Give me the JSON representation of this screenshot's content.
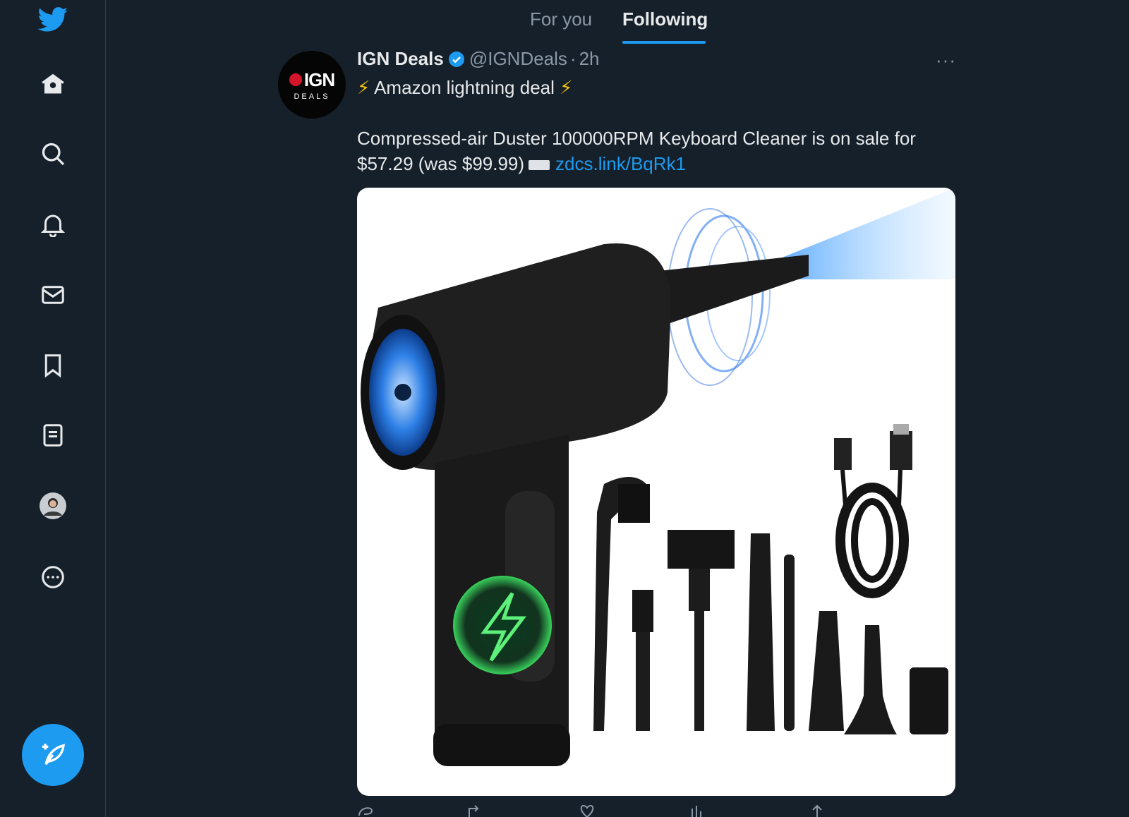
{
  "tabs": [
    {
      "label": "For you",
      "active": false
    },
    {
      "label": "Following",
      "active": true
    }
  ],
  "sidebar": {
    "items": [
      "twitter-logo",
      "home-icon",
      "search-icon",
      "bell-icon",
      "mail-icon",
      "bookmark-icon",
      "list-icon",
      "profile-avatar",
      "more-icon"
    ],
    "compose_icon": "compose-icon"
  },
  "tweet": {
    "author_name": "IGN Deals",
    "handle": "@IGNDeals",
    "separator": "·",
    "time": "2h",
    "more": "···",
    "avatar_logo": "IGN",
    "avatar_sub": "DEALS",
    "headline": "Amazon lightning deal",
    "bolt": "⚡",
    "body": "Compressed-air Duster 100000RPM Keyboard Cleaner is on sale for $57.29 (was $99.99)",
    "link": "zdcs.link/BqRk1"
  },
  "colors": {
    "background": "#15202b",
    "accent": "#1d9bf0",
    "muted": "#8b98a5",
    "text": "#e7e9ea"
  }
}
